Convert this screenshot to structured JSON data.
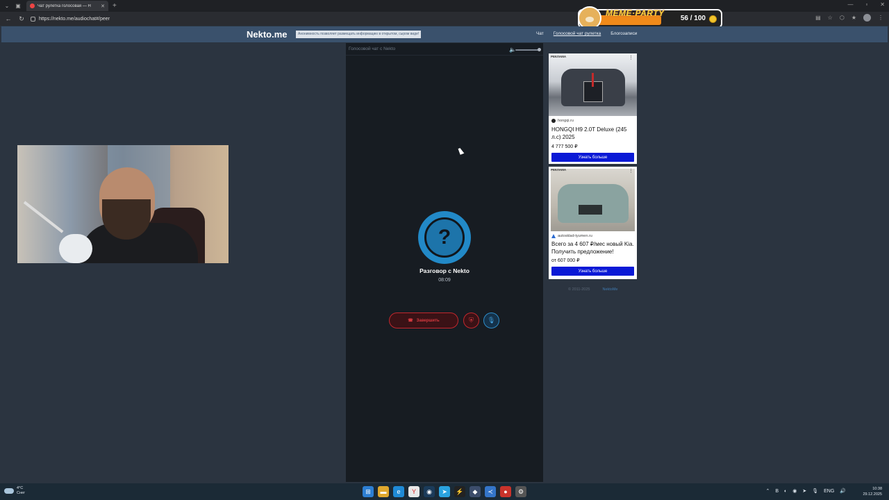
{
  "browser": {
    "tab_title": "Чат рулетка голосовая — Н",
    "url": "https://nekto.me/audiochat#/peer"
  },
  "overlay": {
    "title": "MEME·PARTY",
    "count": "56 / 100"
  },
  "site": {
    "logo": "Nekto.me",
    "notice": "Анонимность позволяет размещать информацию в открытом, сыром виде!",
    "menu": [
      "Чат",
      "Голосовой чат рулетка",
      "Блогозаписи"
    ]
  },
  "chat": {
    "panel_title": "Голосовой чат с Nekto",
    "peer_symbol": "?",
    "peer_name": "Разговор с Nekto",
    "timer": "08:09",
    "end_label": "Завершить"
  },
  "ads": [
    {
      "label": "РЕКЛАМА",
      "source": "hongqi.ru",
      "title": "HONGQI H9 2.0T Deluxe (245 л.с) 2025",
      "price": "4 777 500 ₽",
      "button": "Узнать больше"
    },
    {
      "label": "РЕКЛАМА",
      "source": "autosklad-tyumen.ru",
      "title": "Всего за 4 607 ₽/мес новый Kia. Получить предложение!",
      "price": "от 607 000 ₽",
      "button": "Узнать больше"
    }
  ],
  "footer": {
    "copyright": "© 2011-2025",
    "link": "NektoMe"
  },
  "taskbar": {
    "temperature": "4°C",
    "condition": "Снег",
    "language": "ENG",
    "time": "10:38",
    "date": "29.12.2025"
  },
  "colors": {
    "page_bg": "#2b3440",
    "header_bg": "#3a516c",
    "panel_bg": "#171c22",
    "accent_blue": "#2289c7",
    "end_red": "#c2272d",
    "ad_button": "#0a19d6"
  }
}
